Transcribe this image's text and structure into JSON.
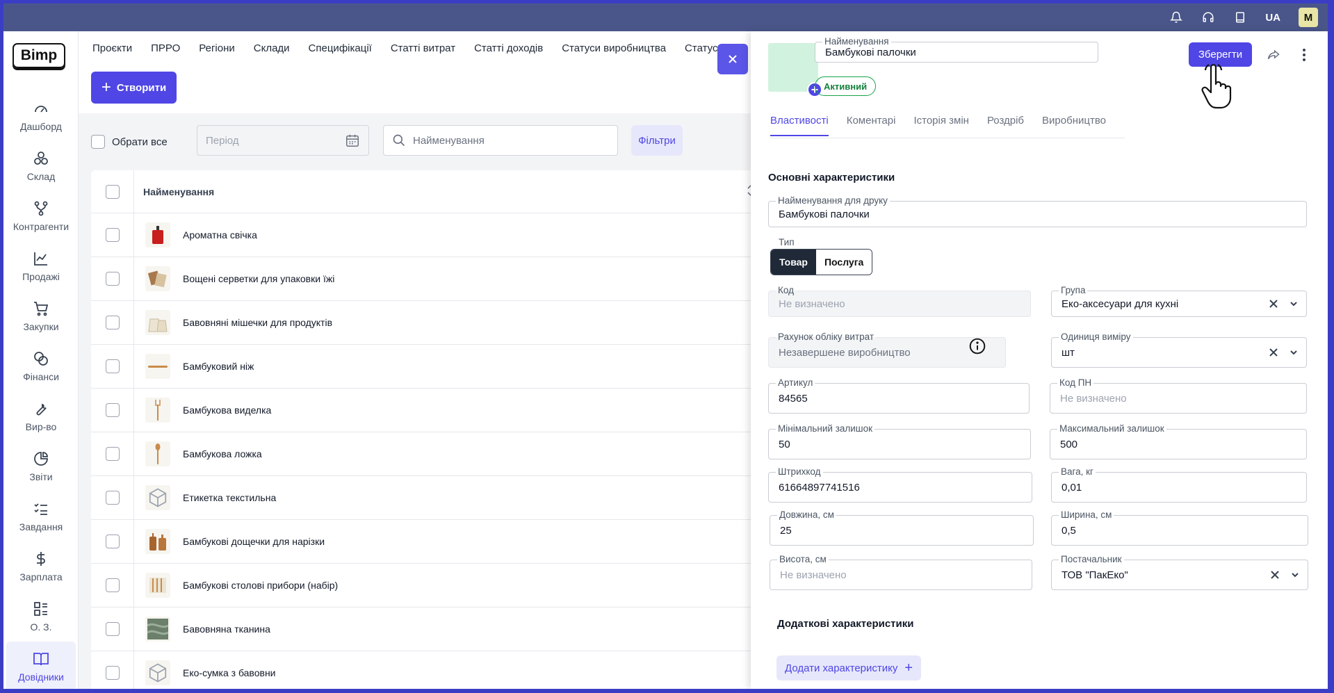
{
  "topbar": {
    "icons": [
      "bell-icon",
      "headset-icon",
      "book-icon"
    ],
    "lang": "UA",
    "avatar": "M"
  },
  "sidebar": {
    "logo": "Bimp",
    "items": [
      {
        "label": "Дашборд",
        "icon": "gauge-icon"
      },
      {
        "label": "Склад",
        "icon": "boxes-icon"
      },
      {
        "label": "Контрагенти",
        "icon": "network-icon"
      },
      {
        "label": "Продажі",
        "icon": "chart-icon"
      },
      {
        "label": "Закупки",
        "icon": "cart-icon"
      },
      {
        "label": "Фінанси",
        "icon": "coins-icon"
      },
      {
        "label": "Вир-во",
        "icon": "wrench-icon"
      },
      {
        "label": "Звіти",
        "icon": "pie-icon"
      },
      {
        "label": "Завдання",
        "icon": "checklist-icon"
      },
      {
        "label": "Зарплата",
        "icon": "dollar-icon"
      },
      {
        "label": "О. З.",
        "icon": "grid-list-icon"
      },
      {
        "label": "Довідники",
        "icon": "open-book-icon",
        "active": true
      }
    ]
  },
  "tabs": [
    "Проєкти",
    "ПРРО",
    "Регіони",
    "Склади",
    "Специфікації",
    "Статті витрат",
    "Статті доходів",
    "Статуси виробництва",
    "Статуси"
  ],
  "actions": {
    "create": "Створити"
  },
  "filters": {
    "select_all": "Обрати все",
    "period_placeholder": "Період",
    "search_placeholder": "Найменування",
    "filters_button": "Фільтри"
  },
  "table": {
    "header": "Найменування",
    "rows": [
      {
        "name": "Ароматна свічка",
        "thumb": "candle"
      },
      {
        "name": "Вощені серветки для упаковки їжі",
        "thumb": "wraps"
      },
      {
        "name": "Бавовняні мішечки для продуктів",
        "thumb": "bags"
      },
      {
        "name": "Бамбуковий ніж",
        "thumb": "knife"
      },
      {
        "name": "Бамбукова виделка",
        "thumb": "fork"
      },
      {
        "name": "Бамбукова ложка",
        "thumb": "spoon"
      },
      {
        "name": "Етикетка текстильна",
        "thumb": "box"
      },
      {
        "name": "Бамбукові дощечки для нарізки",
        "thumb": "boards"
      },
      {
        "name": "Бамбукові столові прибори (набір)",
        "thumb": "cutlery"
      },
      {
        "name": "Бавовняна тканина",
        "thumb": "fabric"
      },
      {
        "name": "Еко-сумка з бавовни",
        "thumb": "box"
      }
    ]
  },
  "panel": {
    "name_label": "Найменування",
    "name_value": "Бамбукові палочки",
    "status": "Активний",
    "save": "Зберегти",
    "tabs": [
      "Властивості",
      "Коментарі",
      "Історія змін",
      "Роздріб",
      "Виробництво"
    ],
    "section_main": "Основні характеристики",
    "print_name_label": "Найменування для друку",
    "print_name_value": "Бамбукові палочки",
    "type_label": "Тип",
    "type_options": [
      "Товар",
      "Послуга"
    ],
    "code_label": "Код",
    "code_placeholder": "Не визначено",
    "group_label": "Група",
    "group_value": "Еко-аксесуари для кухні",
    "account_label": "Рахунок обліку витрат",
    "account_value": "Незавершене виробництво",
    "unit_label": "Одиниця виміру",
    "unit_value": "шт",
    "article_label": "Артикул",
    "article_value": "84565",
    "pn_label": "Код ПН",
    "pn_placeholder": "Не визначено",
    "min_label": "Мінімальний залишок",
    "min_value": "50",
    "max_label": "Максимальний залишок",
    "max_value": "500",
    "barcode_label": "Штрихкод",
    "barcode_value": "61664897741516",
    "weight_label": "Вага, кг",
    "weight_value": "0,01",
    "length_label": "Довжина, см",
    "length_value": "25",
    "width_label": "Ширина, см",
    "width_value": "0,5",
    "height_label": "Висота, см",
    "height_placeholder": "Не визначено",
    "supplier_label": "Постачальник",
    "supplier_value": "ТОВ \"ПакЕко\"",
    "section_extra": "Додаткові характеристики",
    "add_char": "Додати характеристику"
  }
}
